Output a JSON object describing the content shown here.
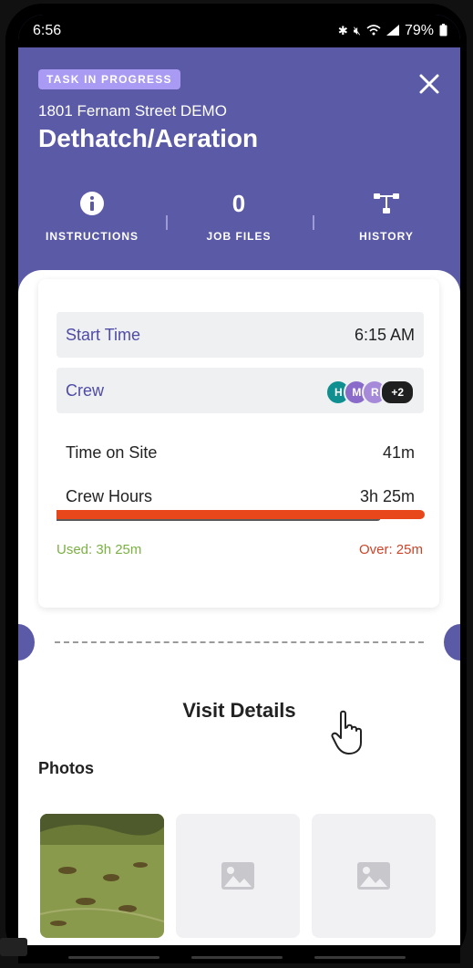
{
  "status_bar": {
    "time": "6:56",
    "battery": "79%"
  },
  "header": {
    "badge": "TASK IN PROGRESS",
    "address": "1801 Fernam Street DEMO",
    "title": "Dethatch/Aeration",
    "actions": [
      {
        "label": "INSTRUCTIONS",
        "icon": "info-icon"
      },
      {
        "label": "JOB FILES",
        "count": "0"
      },
      {
        "label": "HISTORY",
        "icon": "history-icon"
      }
    ]
  },
  "summary": {
    "start_time": {
      "label": "Start Time",
      "value": "6:15 AM"
    },
    "crew": {
      "label": "Crew",
      "members": [
        {
          "initial": "H",
          "color": "#0f8f8f"
        },
        {
          "initial": "M",
          "color": "#8a6bc9"
        },
        {
          "initial": "R",
          "color": "#a68ad9"
        }
      ],
      "more": "+2"
    },
    "time_on_site": {
      "label": "Time on Site",
      "value": "41m"
    },
    "crew_hours": {
      "label": "Crew Hours",
      "value": "3h 25m"
    },
    "progress": {
      "used_fraction": 0.88,
      "over_fraction": 1.0,
      "used_text": "Used: 3h 25m",
      "over_text": "Over: 25m"
    }
  },
  "visit": {
    "title": "Visit Details",
    "photos_label": "Photos"
  },
  "colors": {
    "header": "#5b5aa7",
    "accent": "#4f4ba6",
    "over": "#e8461b",
    "used_text": "#7bb043"
  }
}
